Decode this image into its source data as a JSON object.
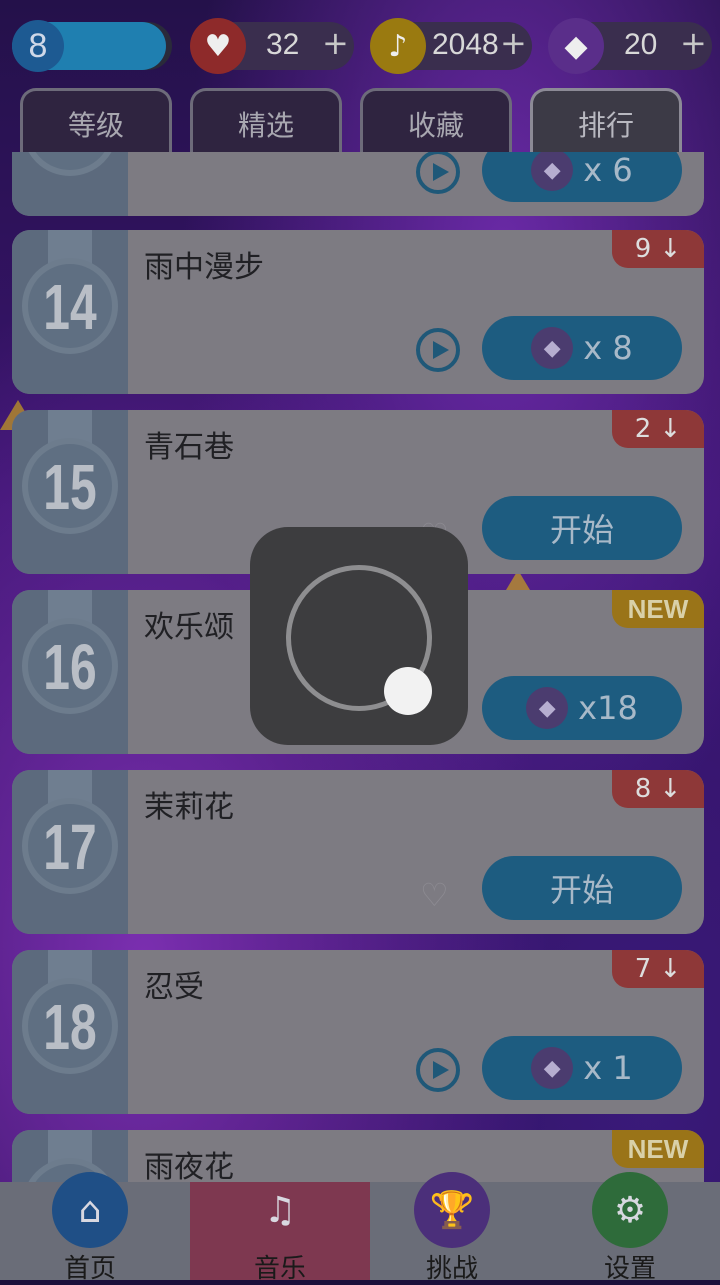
{
  "header": {
    "level": "8",
    "level_progress": 0.96,
    "hearts": "32",
    "notes": "2048",
    "gems": "20",
    "plus": "+"
  },
  "tabs": [
    {
      "label": "等级"
    },
    {
      "label": "精选"
    },
    {
      "label": "收藏"
    },
    {
      "label": "排行",
      "active": true
    }
  ],
  "songs": [
    {
      "rank": "",
      "title": "",
      "badge": "",
      "action": "x 6"
    },
    {
      "rank": "14",
      "title": "雨中漫步",
      "badge": "9 ↓",
      "badge_type": "red",
      "action": "x 8"
    },
    {
      "rank": "15",
      "title": "青石巷",
      "badge": "2 ↓",
      "badge_type": "red",
      "action": "开始"
    },
    {
      "rank": "16",
      "title": "欢乐颂",
      "badge": "NEW",
      "badge_type": "new",
      "action": "x18"
    },
    {
      "rank": "17",
      "title": "茉莉花",
      "badge": "8 ↓",
      "badge_type": "red",
      "action": "开始"
    },
    {
      "rank": "18",
      "title": "忍受",
      "badge": "7 ↓",
      "badge_type": "red",
      "action": "x 1"
    },
    {
      "rank": "",
      "title": "雨夜花",
      "badge": "NEW",
      "badge_type": "new",
      "action": ""
    }
  ],
  "nav": [
    {
      "label": "首页",
      "icon": "home-icon"
    },
    {
      "label": "音乐",
      "icon": "music-note-icon",
      "active": true
    },
    {
      "label": "挑战",
      "icon": "trophy-icon"
    },
    {
      "label": "设置",
      "icon": "gear-icon"
    }
  ],
  "icons": {
    "heart": "♥",
    "note": "♪",
    "gem": "◆",
    "heart_outline": "♡",
    "home": "⌂",
    "music": "♫",
    "trophy": "🏆",
    "gear": "⚙"
  },
  "colors": {
    "heart": "#8e2a2a",
    "note": "#9a7a10",
    "gem": "#5a2e8a",
    "home_nav": "#1f4f86",
    "trophy_nav": "#4b2f7a",
    "gear_nav": "#2e6b3a"
  }
}
